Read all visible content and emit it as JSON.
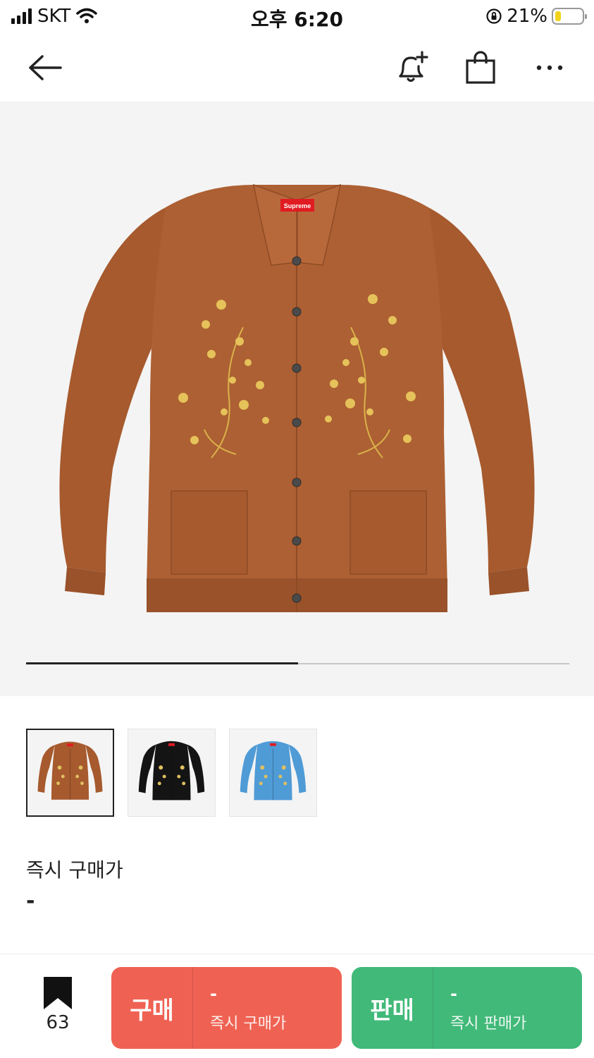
{
  "status_bar": {
    "carrier": "SKT",
    "time": "오후 6:20",
    "battery_percent": "21%",
    "battery_level": 0.21
  },
  "nav": {
    "back_icon": "arrow-left-icon",
    "alert_icon": "bell-plus-icon",
    "bag_icon": "shopping-bag-icon",
    "more_icon": "more-horizontal-icon"
  },
  "product": {
    "image_index_fraction": 0.5,
    "logo_text": "Supreme",
    "thumbnails": [
      {
        "color": "#a65a2e",
        "selected": true
      },
      {
        "color": "#141414",
        "selected": false
      },
      {
        "color": "#4f9bd6",
        "selected": false
      }
    ]
  },
  "price": {
    "label": "즉시 구매가",
    "value": "-"
  },
  "bottom_bar": {
    "bookmark_count": "63",
    "buy": {
      "label": "구매",
      "price": "-",
      "sub": "즉시 구매가",
      "color": "#ef6253"
    },
    "sell": {
      "label": "판매",
      "price": "-",
      "sub": "즉시 판매가",
      "color": "#41b979"
    }
  }
}
